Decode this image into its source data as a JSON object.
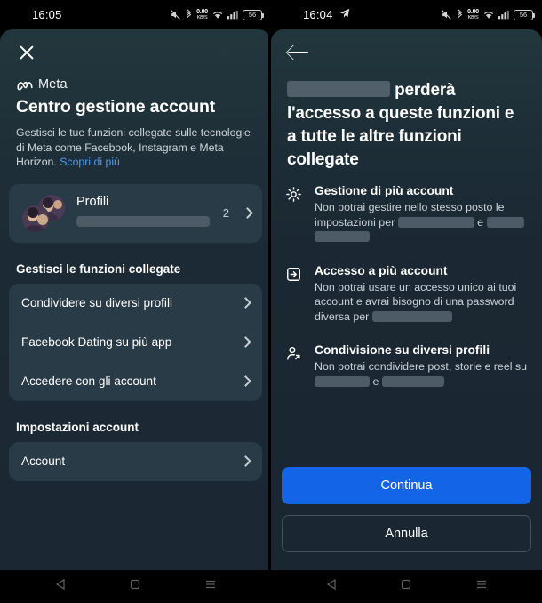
{
  "left_phone": {
    "status_bar": {
      "time": "16:05",
      "data_rate_value": "0.00",
      "data_rate_unit": "KB/S",
      "battery": "56",
      "icons": [
        "mute-icon",
        "bluetooth-icon",
        "data-rate-icon",
        "wifi-icon",
        "signal-icon",
        "battery-icon"
      ]
    },
    "header": {
      "close_label": "Chiudi",
      "brand": "Meta",
      "title": "Centro gestione account",
      "subtitle": "Gestisci le tue funzioni collegate sulle tecnologie di Meta come Facebook, Instagram e Meta Horizon.",
      "link": "Scopri di più"
    },
    "profiles_card": {
      "label": "Profili",
      "redacted_name": "",
      "count": "2"
    },
    "sections": [
      {
        "title": "Gestisci le funzioni collegate",
        "items": [
          {
            "label": "Condividere su diversi profili"
          },
          {
            "label": "Facebook Dating su più app"
          },
          {
            "label": "Accedere con gli account"
          }
        ]
      },
      {
        "title": "Impostazioni account",
        "items": [
          {
            "label": "Account"
          }
        ]
      }
    ]
  },
  "right_phone": {
    "status_bar": {
      "time": "16:04",
      "send_icon": "telegram-send-icon",
      "data_rate_value": "0.00",
      "data_rate_unit": "KB/S",
      "battery": "56",
      "icons": [
        "mute-icon",
        "bluetooth-icon",
        "data-rate-icon",
        "wifi-icon",
        "signal-icon",
        "battery-icon"
      ]
    },
    "header": {
      "back_label": "Indietro"
    },
    "title_prefix_redacted": "",
    "title": "perderà l'accesso a queste funzioni e a tutte le altre funzioni collegate",
    "features": [
      {
        "icon": "gear-icon",
        "heading": "Gestione di più account",
        "desc_part1": "Non potrai gestire nello stesso posto le impostazioni per",
        "desc_conjunction": "e",
        "desc_part3": ""
      },
      {
        "icon": "login-box-icon",
        "heading": "Accesso a più account",
        "desc_part1": "Non potrai usare un accesso unico ai tuoi account e avrai bisogno di una password diversa per",
        "desc_conjunction": "",
        "desc_part3": ""
      },
      {
        "icon": "person-share-icon",
        "heading": "Condivisione su diversi profili",
        "desc_part1": "Non potrai condividere post, storie e reel su",
        "desc_conjunction": "e",
        "desc_part3": ""
      }
    ],
    "buttons": {
      "primary": "Continua",
      "secondary": "Annulla"
    }
  },
  "nav_bar": {
    "back": "back-triangle-icon",
    "home": "home-square-icon",
    "recents": "recents-lines-icon"
  },
  "colors": {
    "accent_blue": "#1464e8",
    "link_blue": "#4a9bea",
    "card_bg": "#2a3b48",
    "app_bg": "#1b2833"
  }
}
